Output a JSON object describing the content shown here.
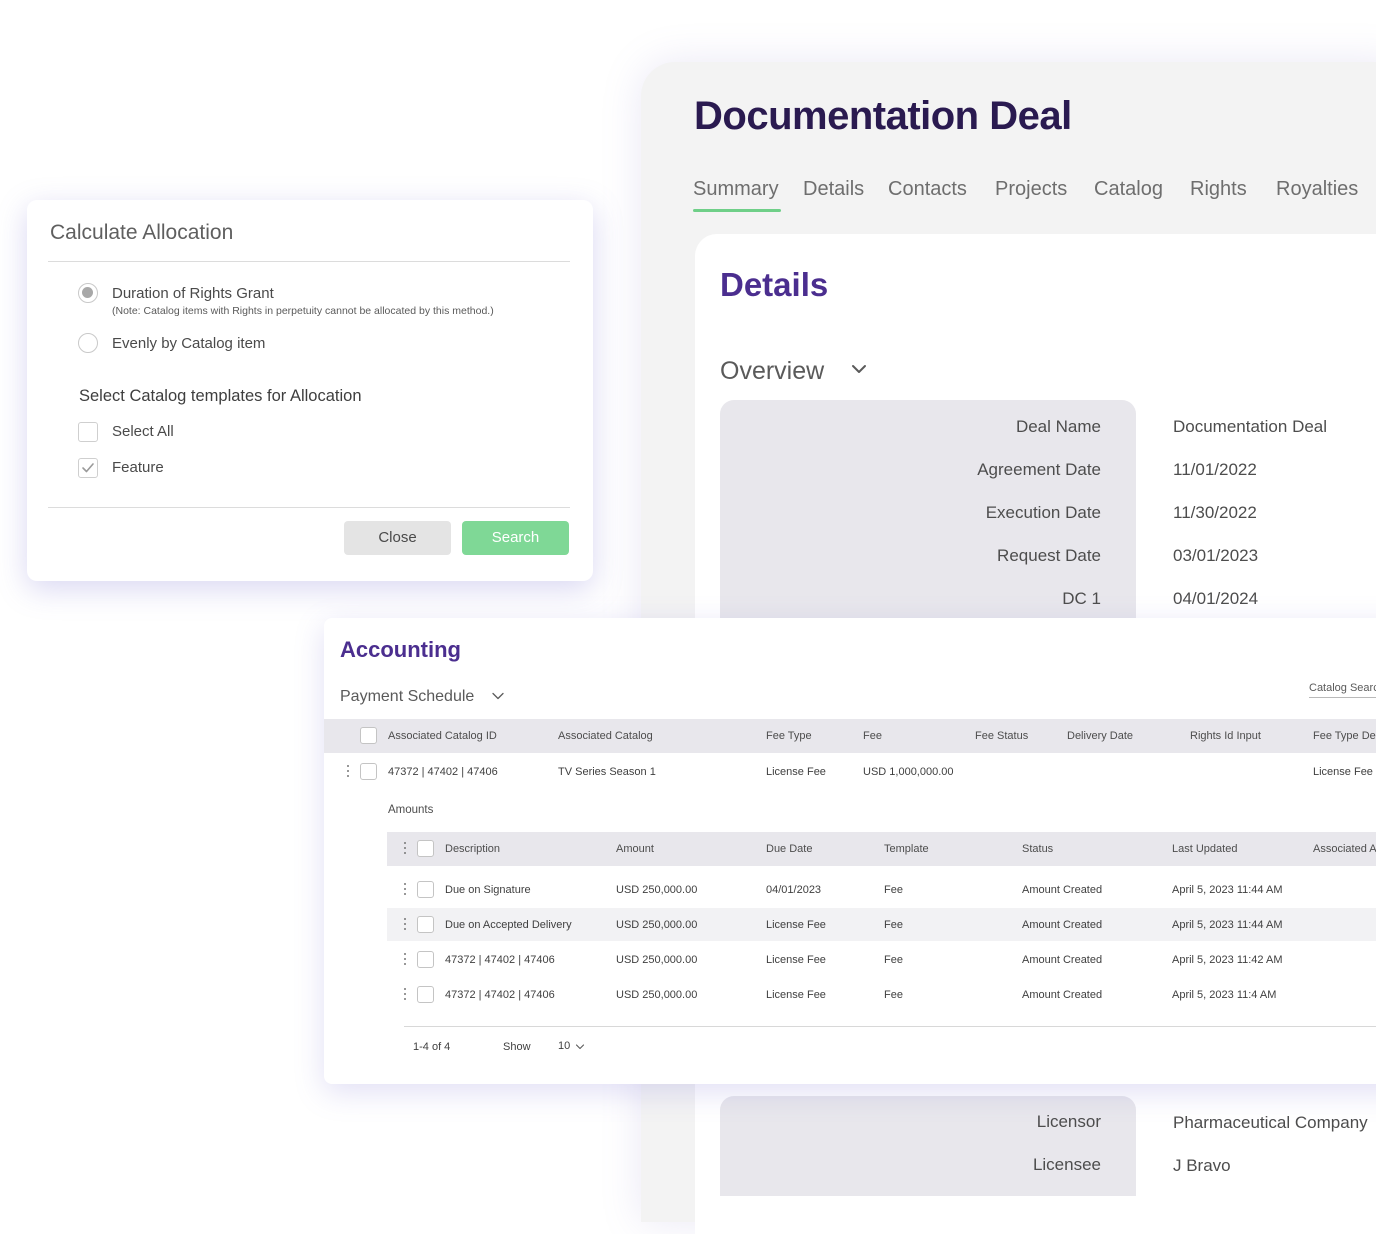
{
  "deal": {
    "title": "Documentation Deal",
    "tabs": [
      "Summary",
      "Details",
      "Contacts",
      "Projects",
      "Catalog",
      "Rights",
      "Royalties"
    ],
    "active_tab": "Summary",
    "details_heading": "Details",
    "overview_heading": "Overview",
    "fields": [
      {
        "label": "Deal Name",
        "value": "Documentation Deal"
      },
      {
        "label": "Agreement Date",
        "value": "11/01/2022"
      },
      {
        "label": "Execution Date",
        "value": "11/30/2022"
      },
      {
        "label": "Request Date",
        "value": "03/01/2023"
      },
      {
        "label": "DC 1",
        "value": "04/01/2024"
      }
    ],
    "parties": [
      {
        "label": "Licensor",
        "value": "Pharmaceutical Company"
      },
      {
        "label": "Licensee",
        "value": "J Bravo"
      }
    ]
  },
  "allocation": {
    "title": "Calculate Allocation",
    "options": [
      {
        "label": "Duration of Rights Grant",
        "note": "(Note: Catalog items with Rights in perpetuity cannot be allocated by this method.)",
        "selected": true
      },
      {
        "label": "Evenly by Catalog item",
        "selected": false
      }
    ],
    "templates_heading": "Select Catalog templates for Allocation",
    "checkboxes": [
      {
        "label": "Select All",
        "checked": false
      },
      {
        "label": "Feature",
        "checked": true
      }
    ],
    "close_label": "Close",
    "search_label": "Search"
  },
  "accounting": {
    "title": "Accounting",
    "schedule_label": "Payment Schedule",
    "catalog_search_placeholder": "Catalog Search",
    "columns": [
      "Associated Catalog ID",
      "Associated Catalog",
      "Fee Type",
      "Fee",
      "Fee Status",
      "Delivery Date",
      "Rights Id Input",
      "Fee Type De"
    ],
    "row": {
      "catalog_id": "47372  |  47402  |  47406",
      "catalog": "TV Series Season 1",
      "fee_type": "License Fee",
      "fee": "USD 1,000,000.00",
      "fee_type_desc": "License Fee"
    },
    "amounts_label": "Amounts",
    "amount_columns": [
      "Description",
      "Amount",
      "Due Date",
      "Template",
      "Status",
      "Last Updated",
      "Associated A"
    ],
    "amounts": [
      {
        "description": "Due on Signature",
        "amount": "USD 250,000.00",
        "due_date": "04/01/2023",
        "template": "Fee",
        "status": "Amount Created",
        "last_updated": "April 5, 2023  11:44 AM"
      },
      {
        "description": "Due on Accepted Delivery",
        "amount": "USD 250,000.00",
        "due_date": "License Fee",
        "template": "Fee",
        "status": "Amount Created",
        "last_updated": "April 5, 2023  11:44 AM"
      },
      {
        "description": "47372  |  47402  |  47406",
        "amount": "USD 250,000.00",
        "due_date": "License Fee",
        "template": "Fee",
        "status": "Amount Created",
        "last_updated": "April 5, 2023  11:42 AM"
      },
      {
        "description": "47372  |  47402  |  47406",
        "amount": "USD 250,000.00",
        "due_date": "License Fee",
        "template": "Fee",
        "status": "Amount Created",
        "last_updated": "April 5, 2023  11:4 AM"
      }
    ],
    "pagination": {
      "range": "1-4 of 4",
      "show_label": "Show",
      "page_size": "10"
    }
  },
  "colors": {
    "accent_purple": "#4b2e8f",
    "title_dark": "#2a1a50",
    "green": "#7fd896",
    "tab_underline": "#6fcf88"
  }
}
